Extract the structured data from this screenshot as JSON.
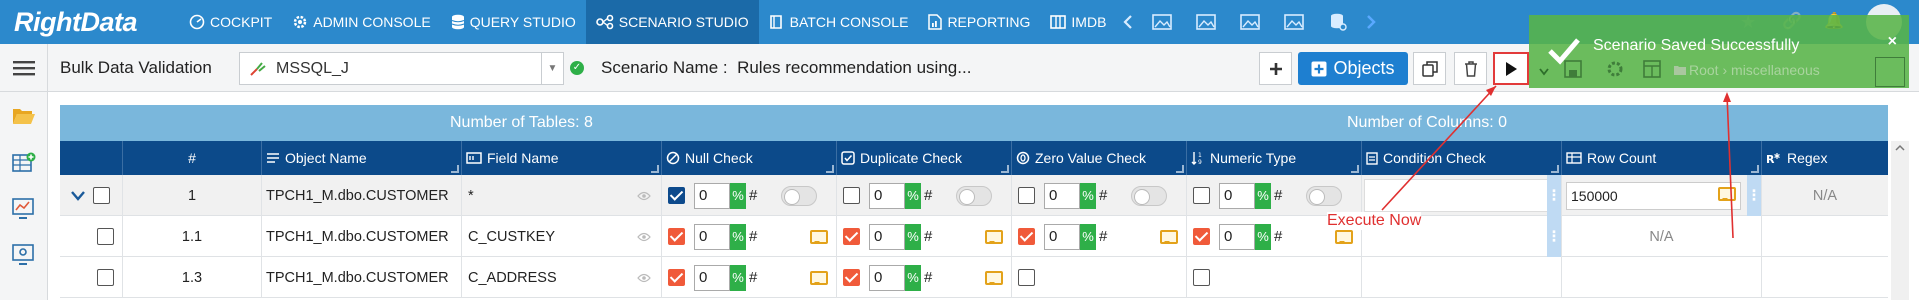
{
  "app": {
    "logo": "RightData"
  },
  "nav": {
    "items": [
      {
        "label": "COCKPIT",
        "icon": "cockpit-icon"
      },
      {
        "label": "ADMIN CONSOLE",
        "icon": "gear-icon"
      },
      {
        "label": "QUERY STUDIO",
        "icon": "database-icon"
      },
      {
        "label": "SCENARIO STUDIO",
        "icon": "scenario-icon",
        "active": true
      },
      {
        "label": "BATCH CONSOLE",
        "icon": "book-icon"
      },
      {
        "label": "REPORTING",
        "icon": "report-icon"
      },
      {
        "label": "IMDB",
        "icon": "columns-icon"
      }
    ]
  },
  "toolbar": {
    "page_title": "Bulk Data Validation",
    "datasource": "MSSQL_J",
    "scenario_label": "Scenario Name :",
    "scenario_name": "Rules recommendation using...",
    "objects_label": "Objects",
    "breadcrumb_root": "Root",
    "breadcrumb_sep": "›",
    "breadcrumb_leaf": "miscellaneous"
  },
  "toast": {
    "message": "Scenario Saved Successfully",
    "close": "×"
  },
  "banner": {
    "tables": "Number of Tables: 8",
    "columns": "Number of Columns: 0"
  },
  "table": {
    "headers": {
      "index": "#",
      "object_name": "Object Name",
      "field_name": "Field Name",
      "null_check": "Null Check",
      "duplicate_check": "Duplicate Check",
      "zero_value_check": "Zero Value Check",
      "numeric_type": "Numeric Type",
      "condition_check": "Condition Check",
      "row_count": "Row Count",
      "regex": "Regex"
    },
    "rows": [
      {
        "index": "1",
        "object": "TPCH1_M.dbo.CUSTOMER",
        "field": "*",
        "null_val": "0",
        "dup_val": "0",
        "zero_val": "0",
        "num_val": "0",
        "row_count": "150000",
        "regex": "N/A"
      },
      {
        "index": "1.1",
        "object": "TPCH1_M.dbo.CUSTOMER",
        "field": "C_CUSTKEY",
        "null_val": "0",
        "dup_val": "0",
        "zero_val": "0",
        "num_val": "0",
        "row_count": "N/A"
      },
      {
        "index": "1.3",
        "object": "TPCH1_M.dbo.CUSTOMER",
        "field": "C_ADDRESS",
        "null_val": "0",
        "dup_val": "0"
      }
    ],
    "pct_symbol": "%",
    "hash_symbol": "#"
  },
  "annotation": {
    "callout": "Execute Now",
    "color": "#e03030"
  }
}
